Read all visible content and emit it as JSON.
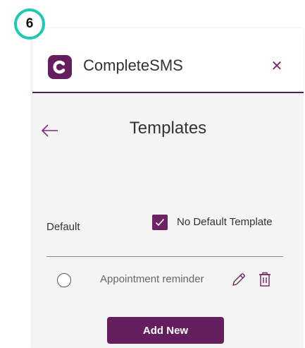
{
  "step_badge": {
    "number": "6"
  },
  "header": {
    "app_name": "CompleteSMS",
    "logo_icon": "completesms-logo-icon",
    "close_icon": "close-icon",
    "close_glyph": "✕"
  },
  "nav": {
    "back_icon": "arrow-left-icon"
  },
  "page": {
    "title": "Templates"
  },
  "default_row": {
    "label": "Default",
    "checkbox_checked": true,
    "checkbox_label": "No Default Template"
  },
  "templates": [
    {
      "name": "Appointment reminder",
      "selected": false,
      "edit_icon": "pencil-icon",
      "delete_icon": "trash-icon"
    }
  ],
  "actions": {
    "add_new_label": "Add New"
  },
  "colors": {
    "brand": "#641e5d",
    "badge_ring": "#1fc9b0",
    "panel_bg": "#f4f4f4"
  }
}
